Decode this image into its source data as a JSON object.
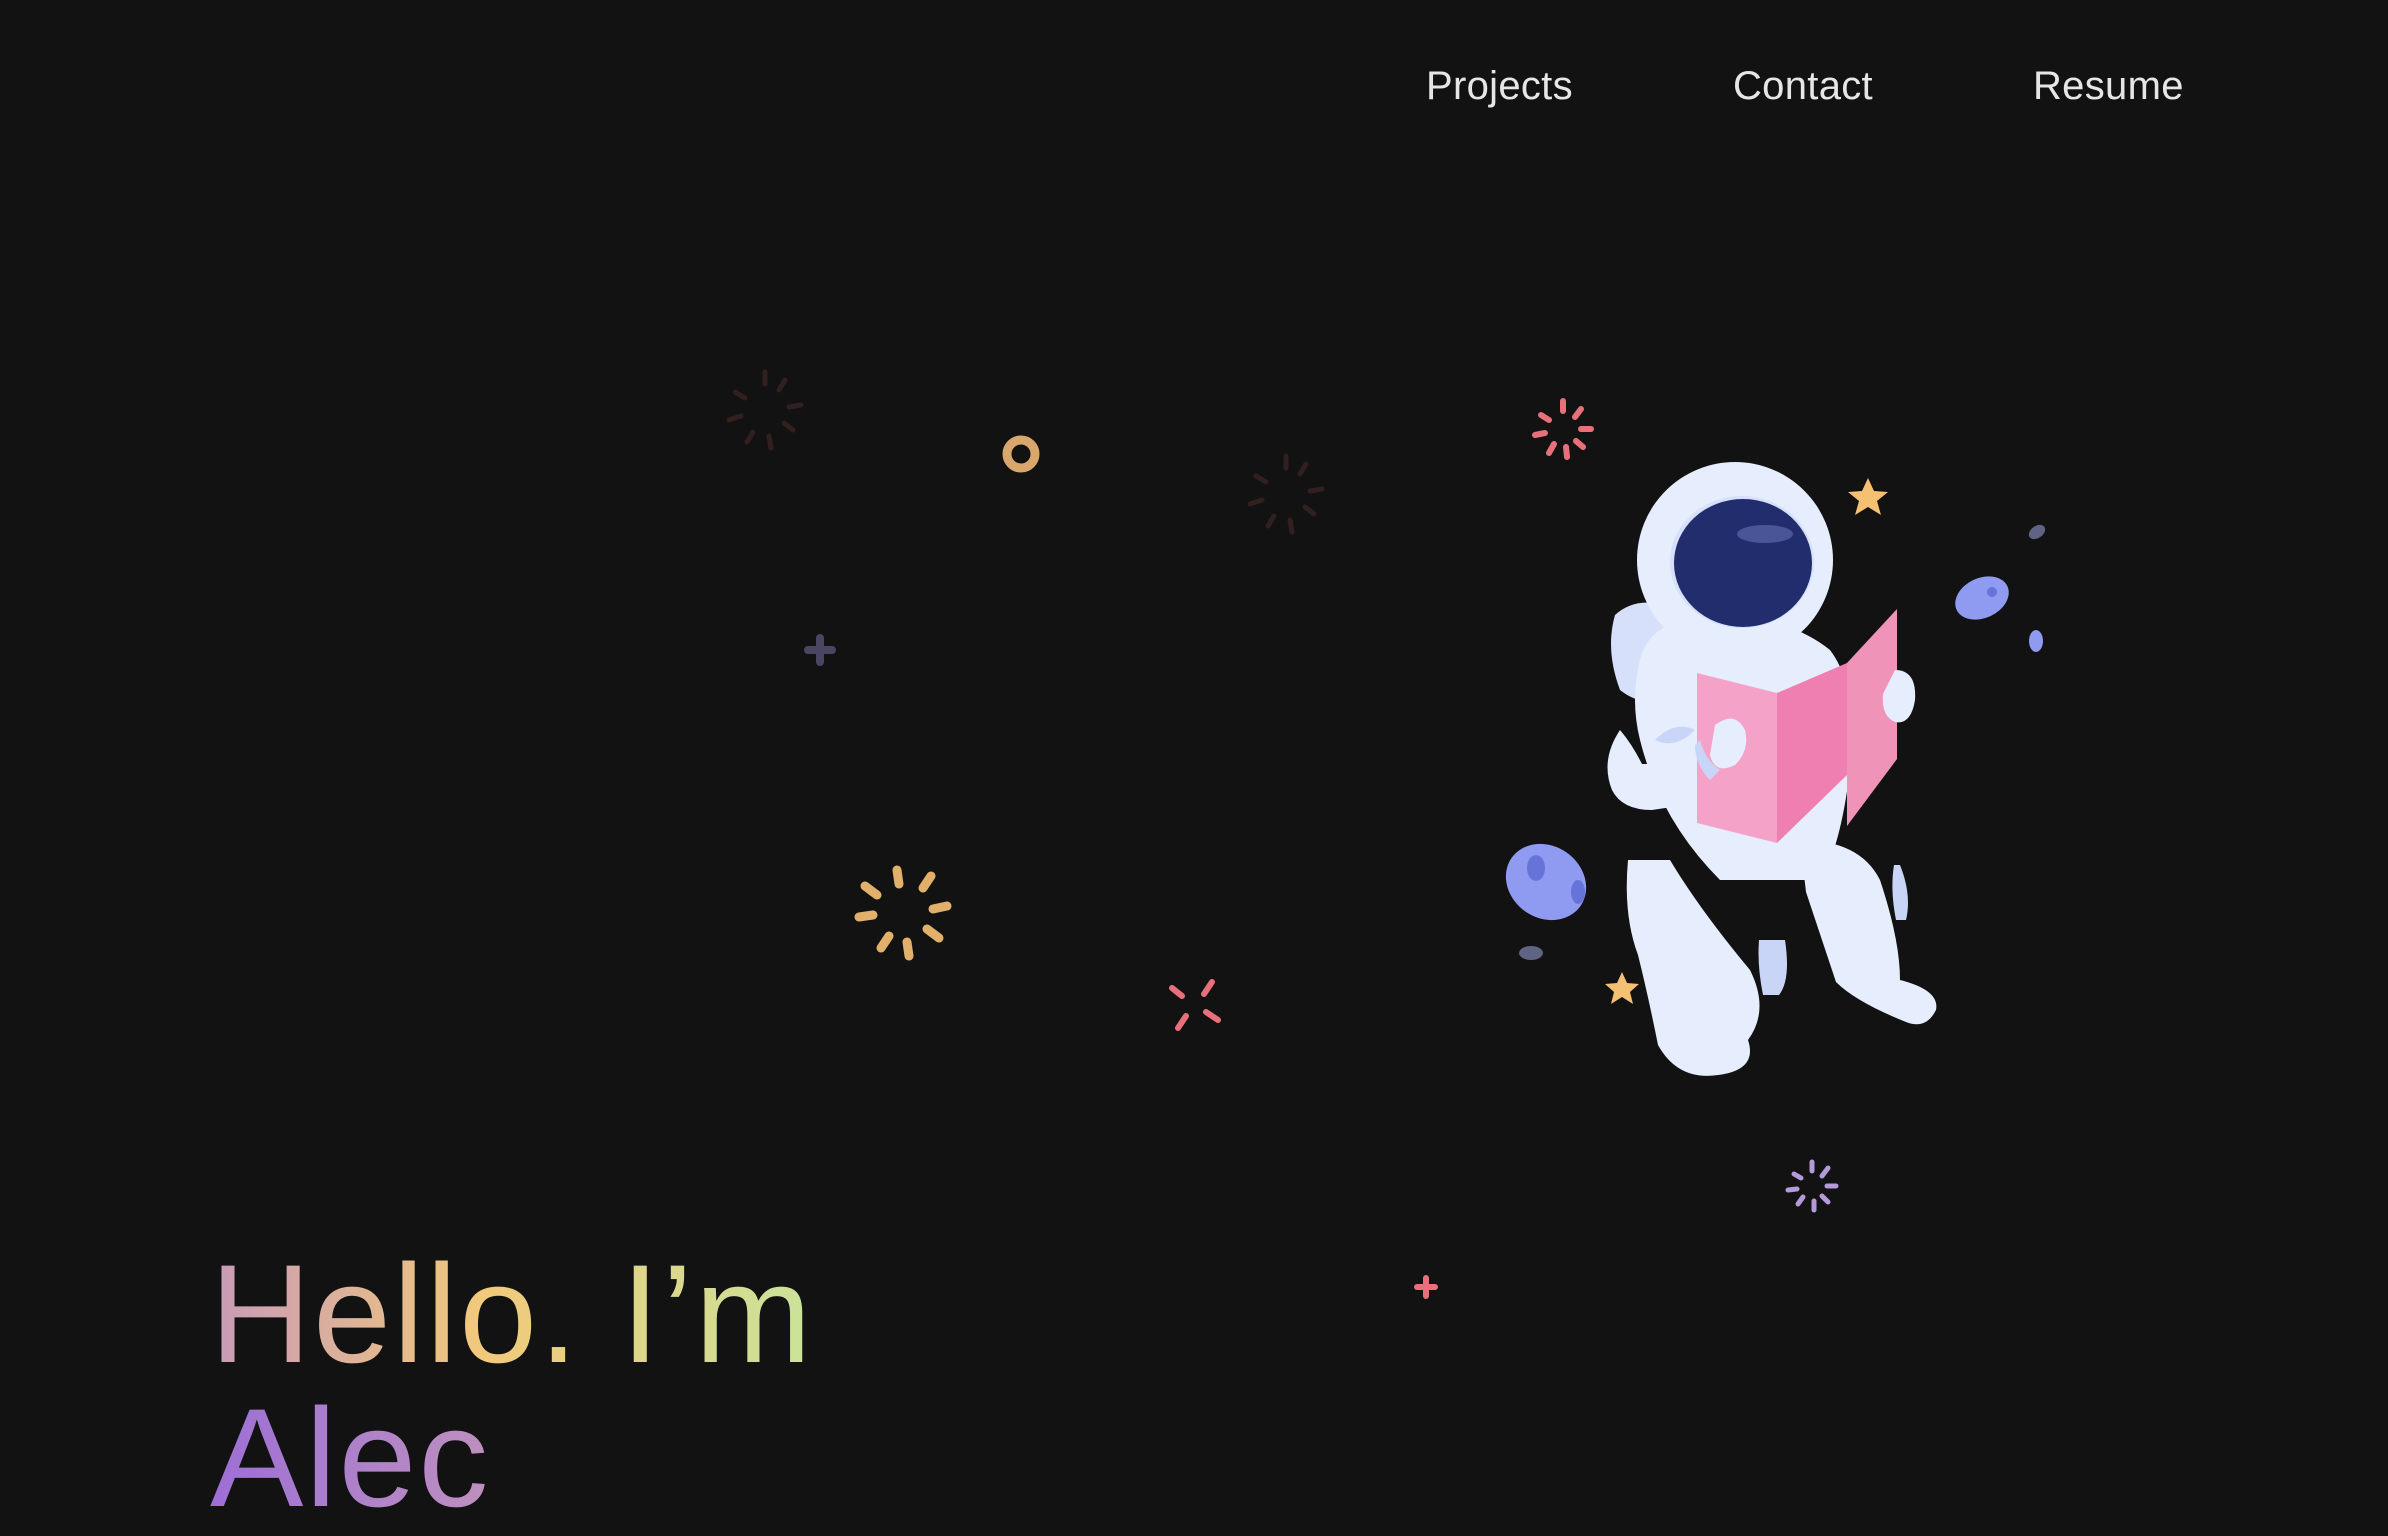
{
  "nav": {
    "items": [
      {
        "label": "Projects"
      },
      {
        "label": "Contact"
      },
      {
        "label": "Resume"
      }
    ]
  },
  "hero": {
    "line1": "Hello. I’m",
    "line2": "Alec"
  },
  "colors": {
    "background": "#121212",
    "nav_text": "#e6e6e6",
    "accent_pink": "#f093b8",
    "accent_gold": "#f2c97a",
    "accent_blue": "#8f9bf0",
    "visor": "#222d6e"
  },
  "illustration": {
    "icon": "astronaut-reading-icon"
  }
}
